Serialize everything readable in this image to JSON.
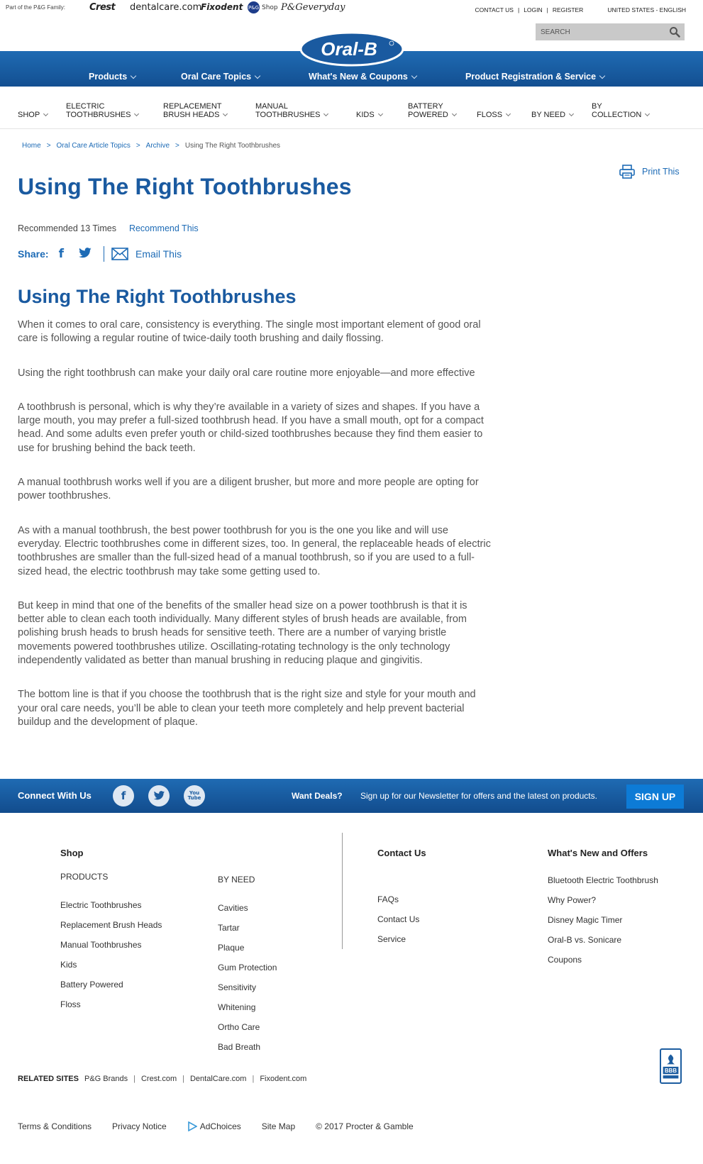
{
  "family_bar": {
    "label": "Part of the P&G Family:",
    "brands": [
      "Crest",
      "dentalcare.com",
      "Fixodent",
      "Shop",
      "P&Geveryday"
    ],
    "pg_mark": "P&G"
  },
  "utility": {
    "contact": "CONTACT US",
    "login": "LOGIN",
    "register": "REGISTER",
    "separator": "|",
    "locale": "UNITED STATES - ENGLISH"
  },
  "search": {
    "placeholder": "SEARCH"
  },
  "logo": {
    "text": "Oral-B"
  },
  "main_nav": [
    {
      "label": "Products"
    },
    {
      "label": "Oral Care Topics"
    },
    {
      "label": "What's New & Coupons"
    },
    {
      "label": "Product Registration & Service"
    }
  ],
  "sub_nav": [
    {
      "line1": "",
      "line2": "SHOP"
    },
    {
      "line1": "ELECTRIC",
      "line2": "TOOTHBRUSHES"
    },
    {
      "line1": "REPLACEMENT",
      "line2": "BRUSH HEADS"
    },
    {
      "line1": "MANUAL",
      "line2": "TOOTHBRUSHES"
    },
    {
      "line1": "",
      "line2": "KIDS"
    },
    {
      "line1": "BATTERY",
      "line2": "POWERED"
    },
    {
      "line1": "",
      "line2": "FLOSS"
    },
    {
      "line1": "",
      "line2": "BY NEED"
    },
    {
      "line1": "BY",
      "line2": "COLLECTION"
    }
  ],
  "breadcrumb": {
    "items": [
      "Home",
      "Oral Care Article Topics",
      "Archive"
    ],
    "separator": ">",
    "current": "Using The Right Toothbrushes"
  },
  "print": {
    "label": "Print This"
  },
  "page_title": "Using The Right Toothbrushes",
  "recommend": {
    "count_text": "Recommended 13 Times",
    "link": "Recommend This"
  },
  "share": {
    "label": "Share:",
    "facebook": "f",
    "email_label": "Email This"
  },
  "article": {
    "heading": "Using The Right Toothbrushes",
    "paragraphs": [
      "When it comes to oral care, consistency is everything. The single most important element of good oral care is following a regular routine of twice-daily tooth brushing and daily flossing.",
      "Using the right toothbrush can make your daily oral care routine more enjoyable—and more effective",
      "A toothbrush is personal, which is why they’re available in a variety of sizes and shapes. If you have a large mouth, you may prefer a full-sized toothbrush head. If you have a small mouth, opt for a compact head. And some adults even prefer youth or child-sized toothbrushes because they find them easier to use for brushing behind the back teeth.",
      "A manual toothbrush works well if you are a diligent brusher, but more and more people are opting for power toothbrushes.",
      "As with a manual toothbrush, the best power toothbrush for you is the one you like and will use everyday. Electric toothbrushes come in different sizes, too. In general, the replaceable heads of electric toothbrushes are smaller than the full-sized head of a manual toothbrush, so if you are used to a full-sized head, the electric toothbrush may take some getting used to.",
      "But keep in mind that one of the benefits of the smaller head size on a power toothbrush is that it is better able to clean each tooth individually. Many different styles of brush heads are available, from polishing brush heads to brush heads for sensitive teeth. There are a number of varying bristle movements powered toothbrushes utilize. Oscillating-rotating technology is the only technology independently validated as better than manual brushing in reducing plaque and gingivitis.",
      "The bottom line is that if you choose the toothbrush that is the right size and style for your mouth and your oral care needs, you’ll be able to clean your teeth more completely and help prevent bacterial buildup and the development of plaque."
    ]
  },
  "connect": {
    "title": "Connect With Us",
    "facebook": "f",
    "youtube": "You Tube",
    "want_deals": "Want Deals?",
    "deals_text": "Sign up for our Newsletter for offers and the latest on products.",
    "signup": "SIGN UP"
  },
  "footer": {
    "shop_head": "Shop",
    "products_head": "PRODUCTS",
    "products": [
      "Electric Toothbrushes",
      "Replacement Brush Heads",
      "Manual Toothbrushes",
      "Kids",
      "Battery Powered",
      "Floss"
    ],
    "by_need_head": "BY NEED",
    "by_need": [
      "Cavities",
      "Tartar",
      "Plaque",
      "Gum Protection",
      "Sensitivity",
      "Whitening",
      "Ortho Care",
      "Bad Breath"
    ],
    "contact_head": "Contact Us",
    "contact": [
      "FAQs",
      "Contact Us",
      "Service"
    ],
    "whats_new_head": "What's New and Offers",
    "whats_new": [
      "Bluetooth Electric Toothbrush",
      "Why Power?",
      "Disney Magic Timer",
      "Oral-B vs. Sonicare",
      "Coupons"
    ]
  },
  "related": {
    "label": "RELATED SITES",
    "sites": [
      "P&G Brands",
      "Crest.com",
      "DentalCare.com",
      "Fixodent.com"
    ],
    "separator": "|"
  },
  "bbb": {
    "text": "BBB"
  },
  "bottom": {
    "terms": "Terms & Conditions",
    "privacy": "Privacy Notice",
    "adchoices": "AdChoices",
    "sitemap": "Site Map",
    "copyright": "© 2017 Procter & Gamble"
  },
  "colors": {
    "brand_blue": "#1a5aa0",
    "nav_blue": "#1f6bb3",
    "link_blue": "#1d6bb6",
    "signup_blue": "#0d7bd6"
  }
}
